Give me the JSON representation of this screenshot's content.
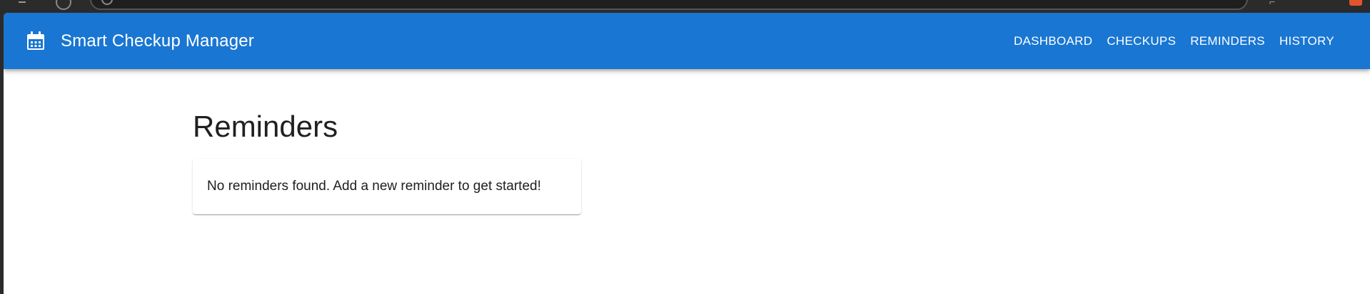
{
  "app": {
    "title": "Smart Checkup Manager",
    "brand_icon": "calendar-icon",
    "accent_color": "#1976d2"
  },
  "nav": {
    "items": [
      {
        "label": "DASHBOARD"
      },
      {
        "label": "CHECKUPS"
      },
      {
        "label": "REMINDERS"
      },
      {
        "label": "HISTORY"
      }
    ]
  },
  "page": {
    "title": "Reminders",
    "empty_message": "No reminders found. Add a new reminder to get started!"
  }
}
